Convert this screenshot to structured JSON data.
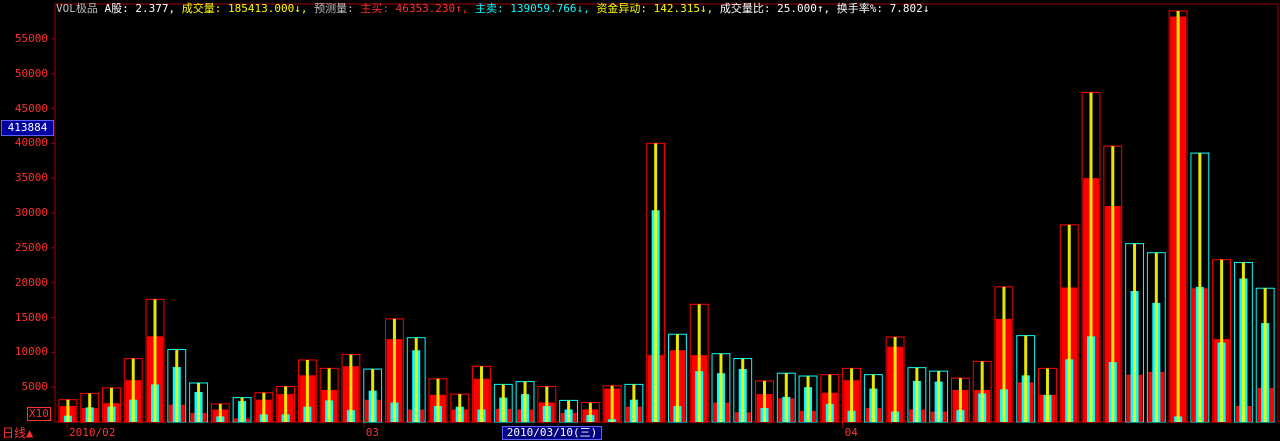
{
  "header": {
    "indicator": "VOL极品",
    "items": [
      {
        "text": "A股: 2.377,",
        "color": "#ffffff"
      },
      {
        "text": "成交量: 185413.000↓,",
        "color": "#ffff00"
      },
      {
        "text": "预测量: ",
        "color": "#c0c0c0"
      },
      {
        "text": "主买: 46353.230↑,",
        "color": "#ff3030"
      },
      {
        "text": "主卖: 139059.766↓,",
        "color": "#00ffff"
      },
      {
        "text": "资金异动: 142.315↓,",
        "color": "#ffff00"
      },
      {
        "text": "成交量比: 25.000↑,",
        "color": "#ffffff"
      },
      {
        "text": "换手率%: 7.802↓",
        "color": "#ffffff"
      }
    ]
  },
  "cursor_value": "413884",
  "x10_label": "X10",
  "period_label": "日线▲",
  "selected_date": "2010/03/10(三)",
  "colors": {
    "background": "#000000",
    "axis": "#a00000",
    "buy": "#ff0000",
    "sell": "#00ffff",
    "total": "#ffff00"
  },
  "chart_data": {
    "type": "bar",
    "ylim": [
      0,
      60000
    ],
    "yticks": [
      5000,
      10000,
      15000,
      20000,
      25000,
      30000,
      35000,
      40000,
      45000,
      50000,
      55000
    ],
    "x_labels": [
      {
        "text": "2010/02",
        "index": 0
      },
      {
        "text": "03",
        "index": 14
      },
      {
        "text": "04",
        "index": 36
      }
    ],
    "bars": [
      {
        "total": 3200,
        "buy": 2300,
        "sell": 900,
        "dir": "up"
      },
      {
        "total": 4100,
        "buy": 2000,
        "sell": 2100,
        "dir": "up"
      },
      {
        "total": 4900,
        "buy": 2700,
        "sell": 2200,
        "dir": "up"
      },
      {
        "total": 9100,
        "buy": 6000,
        "sell": 3200,
        "dir": "up"
      },
      {
        "total": 17600,
        "buy": 12300,
        "sell": 5400,
        "dir": "up"
      },
      {
        "total": 10400,
        "buy": 2500,
        "sell": 7900,
        "dir": "down"
      },
      {
        "total": 5600,
        "buy": 1300,
        "sell": 4300,
        "dir": "down"
      },
      {
        "total": 2600,
        "buy": 1800,
        "sell": 800,
        "dir": "up"
      },
      {
        "total": 3500,
        "buy": 500,
        "sell": 3000,
        "dir": "down"
      },
      {
        "total": 4200,
        "buy": 3200,
        "sell": 1100,
        "dir": "up"
      },
      {
        "total": 5100,
        "buy": 4000,
        "sell": 1100,
        "dir": "up"
      },
      {
        "total": 8900,
        "buy": 6700,
        "sell": 2200,
        "dir": "up"
      },
      {
        "total": 7700,
        "buy": 4600,
        "sell": 3100,
        "dir": "up"
      },
      {
        "total": 9700,
        "buy": 8000,
        "sell": 1700,
        "dir": "up"
      },
      {
        "total": 7600,
        "buy": 3200,
        "sell": 4500,
        "dir": "down"
      },
      {
        "total": 14800,
        "buy": 11900,
        "sell": 2800,
        "dir": "up"
      },
      {
        "total": 12100,
        "buy": 1800,
        "sell": 10300,
        "dir": "down"
      },
      {
        "total": 6200,
        "buy": 3900,
        "sell": 2300,
        "dir": "up"
      },
      {
        "total": 4000,
        "buy": 1800,
        "sell": 2200,
        "dir": "up"
      },
      {
        "total": 8000,
        "buy": 6200,
        "sell": 1800,
        "dir": "up"
      },
      {
        "total": 5400,
        "buy": 1900,
        "sell": 3500,
        "dir": "down"
      },
      {
        "total": 5800,
        "buy": 1800,
        "sell": 4000,
        "dir": "down"
      },
      {
        "total": 5100,
        "buy": 2800,
        "sell": 2300,
        "dir": "up"
      },
      {
        "total": 3100,
        "buy": 1300,
        "sell": 1800,
        "dir": "down"
      },
      {
        "total": 2800,
        "buy": 1800,
        "sell": 1000,
        "dir": "up"
      },
      {
        "total": 5200,
        "buy": 4800,
        "sell": 400,
        "dir": "up"
      },
      {
        "total": 5400,
        "buy": 2200,
        "sell": 3200,
        "dir": "down"
      },
      {
        "total": 40000,
        "buy": 9600,
        "sell": 30400,
        "dir": "up"
      },
      {
        "total": 12600,
        "buy": 10300,
        "sell": 2300,
        "dir": "down"
      },
      {
        "total": 16900,
        "buy": 9600,
        "sell": 7300,
        "dir": "up"
      },
      {
        "total": 9800,
        "buy": 2800,
        "sell": 7000,
        "dir": "down"
      },
      {
        "total": 9100,
        "buy": 1400,
        "sell": 7600,
        "dir": "down"
      },
      {
        "total": 5900,
        "buy": 4000,
        "sell": 2000,
        "dir": "up"
      },
      {
        "total": 7000,
        "buy": 3400,
        "sell": 3600,
        "dir": "down"
      },
      {
        "total": 6600,
        "buy": 1600,
        "sell": 5000,
        "dir": "down"
      },
      {
        "total": 6800,
        "buy": 4200,
        "sell": 2600,
        "dir": "up"
      },
      {
        "total": 7700,
        "buy": 6000,
        "sell": 1600,
        "dir": "up"
      },
      {
        "total": 6800,
        "buy": 2000,
        "sell": 4800,
        "dir": "down"
      },
      {
        "total": 12200,
        "buy": 10800,
        "sell": 1500,
        "dir": "up"
      },
      {
        "total": 7800,
        "buy": 1800,
        "sell": 5900,
        "dir": "down"
      },
      {
        "total": 7300,
        "buy": 1500,
        "sell": 5800,
        "dir": "down"
      },
      {
        "total": 6300,
        "buy": 4600,
        "sell": 1700,
        "dir": "up"
      },
      {
        "total": 8700,
        "buy": 4600,
        "sell": 4100,
        "dir": "up"
      },
      {
        "total": 19400,
        "buy": 14800,
        "sell": 4700,
        "dir": "up"
      },
      {
        "total": 12400,
        "buy": 5700,
        "sell": 6700,
        "dir": "down"
      },
      {
        "total": 7700,
        "buy": 3900,
        "sell": 3900,
        "dir": "up"
      },
      {
        "total": 28300,
        "buy": 19300,
        "sell": 9000,
        "dir": "up"
      },
      {
        "total": 47300,
        "buy": 35000,
        "sell": 12300,
        "dir": "up"
      },
      {
        "total": 39600,
        "buy": 31000,
        "sell": 8600,
        "dir": "up"
      },
      {
        "total": 25600,
        "buy": 6800,
        "sell": 18800,
        "dir": "down"
      },
      {
        "total": 24300,
        "buy": 7200,
        "sell": 17100,
        "dir": "down"
      },
      {
        "total": 59000,
        "buy": 58200,
        "sell": 800,
        "dir": "up"
      },
      {
        "total": 38600,
        "buy": 19200,
        "sell": 19400,
        "dir": "down"
      },
      {
        "total": 23300,
        "buy": 11900,
        "sell": 11400,
        "dir": "up"
      },
      {
        "total": 22900,
        "buy": 2300,
        "sell": 20600,
        "dir": "down"
      },
      {
        "total": 19200,
        "buy": 4900,
        "sell": 14200,
        "dir": "down"
      }
    ]
  }
}
